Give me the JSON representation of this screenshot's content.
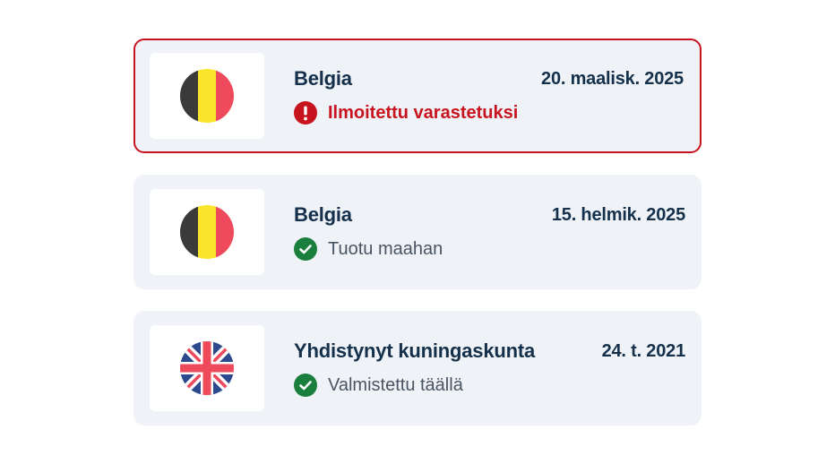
{
  "items": [
    {
      "country": "Belgia",
      "date": "20. maalisk. 2025",
      "status": "Ilmoitettu varastetuksi",
      "status_type": "alert",
      "flag_icon": "belgium-flag-icon"
    },
    {
      "country": "Belgia",
      "date": "15. helmik. 2025",
      "status": "Tuotu maahan",
      "status_type": "ok",
      "flag_icon": "belgium-flag-icon"
    },
    {
      "country": "Yhdistynyt kuningaskunta",
      "date": "24. t. 2021",
      "status": "Valmistettu täällä",
      "status_type": "ok",
      "flag_icon": "united-kingdom-flag-icon"
    }
  ],
  "colors": {
    "alert": "#c8141e",
    "ok": "#1a7f3c",
    "card_bg": "#eff2f7",
    "heading": "#14304a"
  }
}
